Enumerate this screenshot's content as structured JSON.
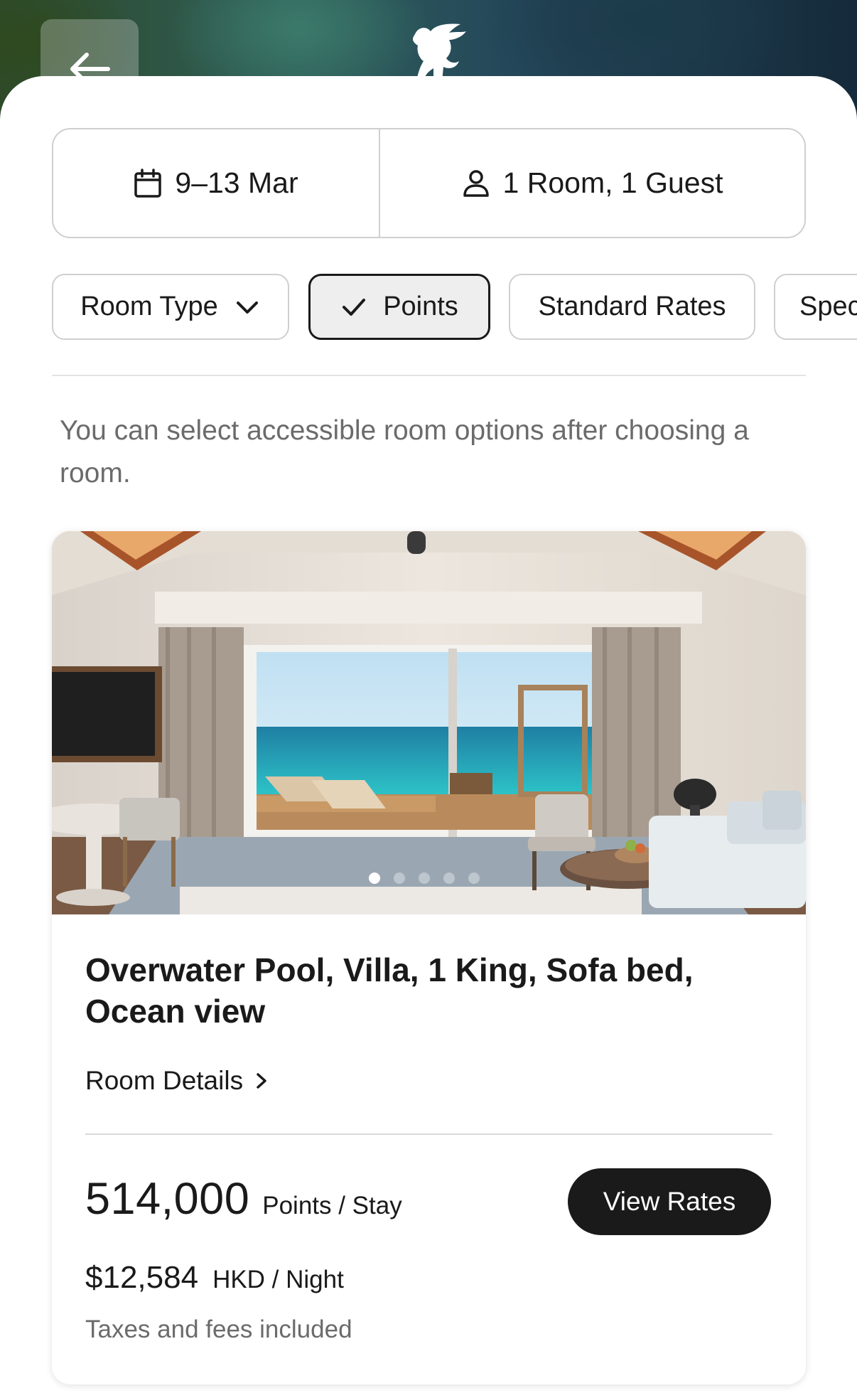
{
  "header": {
    "back_icon": "arrow-left-icon",
    "logo_icon": "griffin-logo-icon"
  },
  "search": {
    "dates_icon": "calendar-icon",
    "dates": "9–13 Mar",
    "guests_icon": "person-icon",
    "guests": "1 Room, 1 Guest"
  },
  "filters": [
    {
      "label": "Room Type",
      "icon": "chevron-down-icon",
      "selected": false
    },
    {
      "label": "Points",
      "icon": "check-icon",
      "selected": true
    },
    {
      "label": "Standard Rates",
      "selected": false
    },
    {
      "label": "Spec",
      "selected": false
    }
  ],
  "notice": "You can select accessible room options after choosing a room.",
  "room": {
    "photo_icon": "villa-ocean-view-photo",
    "carousel": {
      "count": 5,
      "active_index": 0
    },
    "title": "Overwater Pool, Villa, 1 King, Sofa bed, Ocean view",
    "details_label": "Room Details",
    "details_icon": "chevron-right-icon",
    "points_value": "514,000",
    "points_unit": "Points / Stay",
    "view_rates_label": "View Rates",
    "price_value": "$12,584",
    "price_unit": "HKD / Night",
    "taxes_note": "Taxes and fees included"
  },
  "colors": {
    "primary": "#1a1a1a",
    "muted_text": "#6b6b6b",
    "border": "#cfcfcf",
    "selected_chip_bg": "#eeeeee"
  }
}
